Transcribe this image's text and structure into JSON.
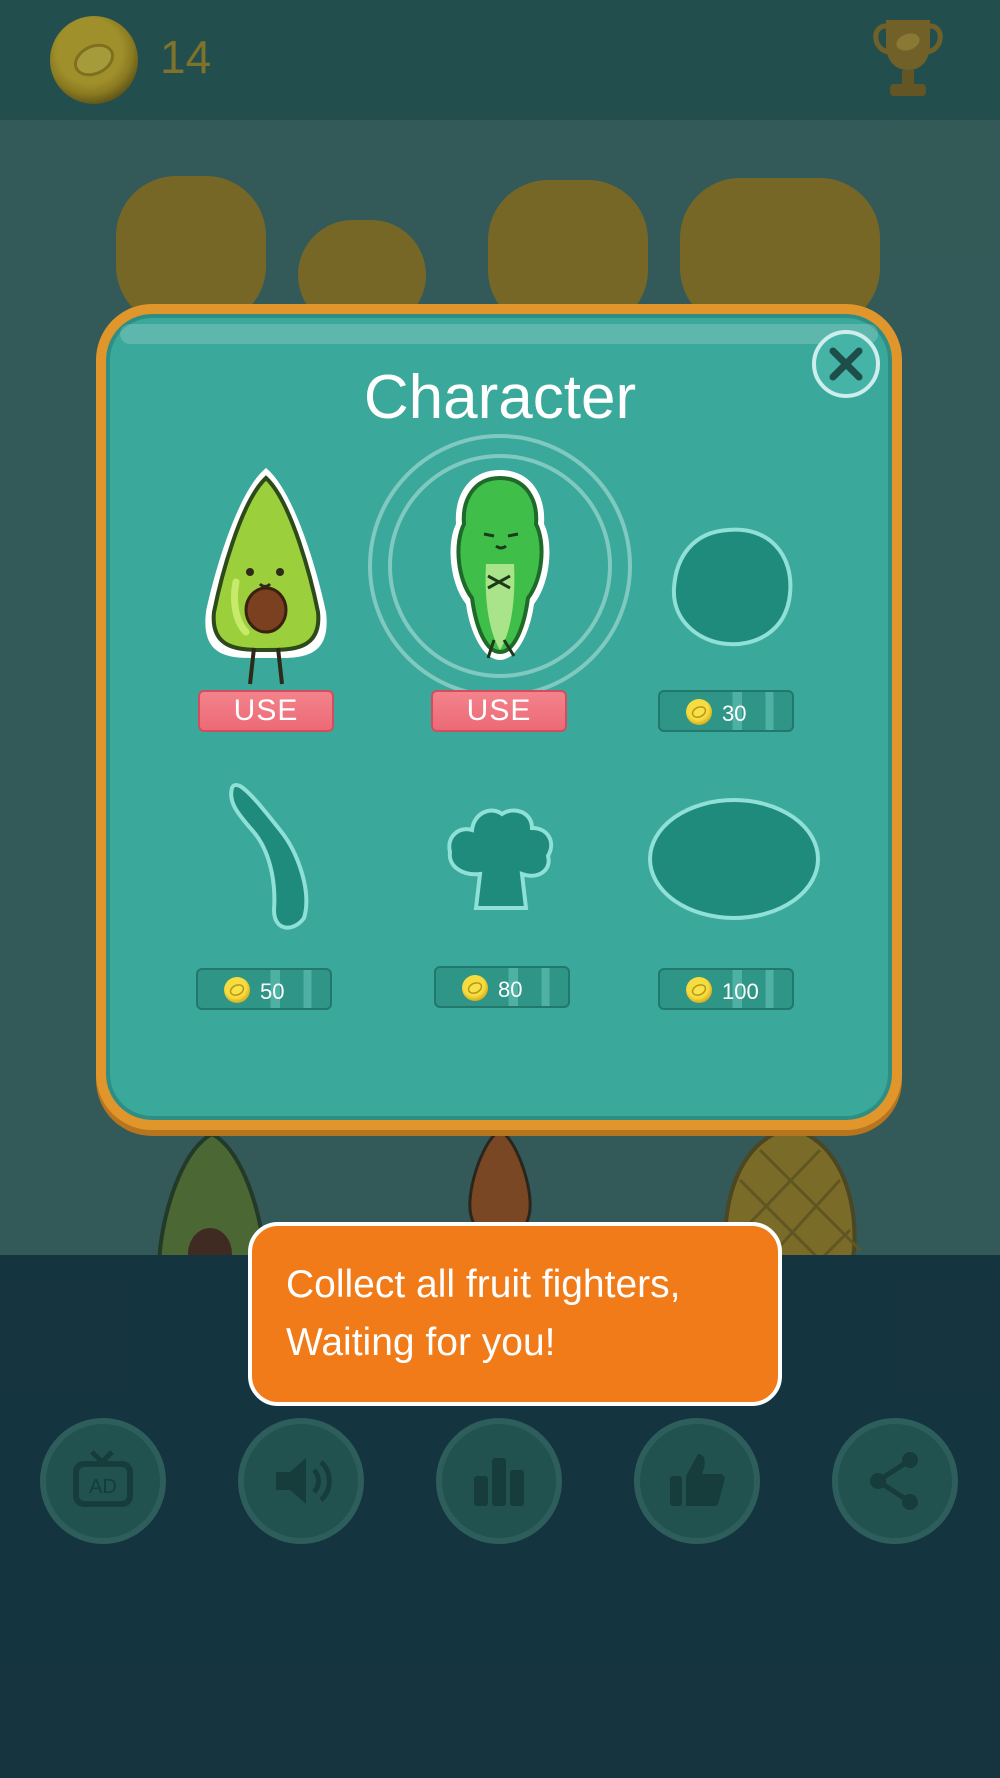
{
  "hud": {
    "coins": "14",
    "coin_icon": "lemon-coin-icon",
    "trophy_icon": "trophy-icon"
  },
  "menu": {
    "buttons": [
      {
        "icon": "ad-tv-icon",
        "label": "AD"
      },
      {
        "icon": "speaker-icon"
      },
      {
        "icon": "leaderboard-icon"
      },
      {
        "icon": "thumbs-up-icon"
      },
      {
        "icon": "share-icon"
      }
    ]
  },
  "dialog": {
    "title": "Character",
    "close_icon": "close-icon",
    "characters": [
      {
        "name": "avocado",
        "owned": true,
        "action": "USE",
        "selected": false
      },
      {
        "name": "lettuce",
        "owned": true,
        "action": "USE",
        "selected": true
      },
      {
        "name": "egg-shape",
        "owned": false,
        "price": "30"
      },
      {
        "name": "banana-shape",
        "owned": false,
        "price": "50"
      },
      {
        "name": "broccoli-shape",
        "owned": false,
        "price": "80"
      },
      {
        "name": "oval-shape",
        "owned": false,
        "price": "100"
      }
    ]
  },
  "toast": {
    "line1": "Collect all fruit fighters,",
    "line2": "Waiting for you!"
  },
  "colors": {
    "dialog_bg": "#3aa89a",
    "dialog_border": "#e0962a",
    "use_button": "#ec6a76",
    "toast_bg": "#f07b18"
  }
}
